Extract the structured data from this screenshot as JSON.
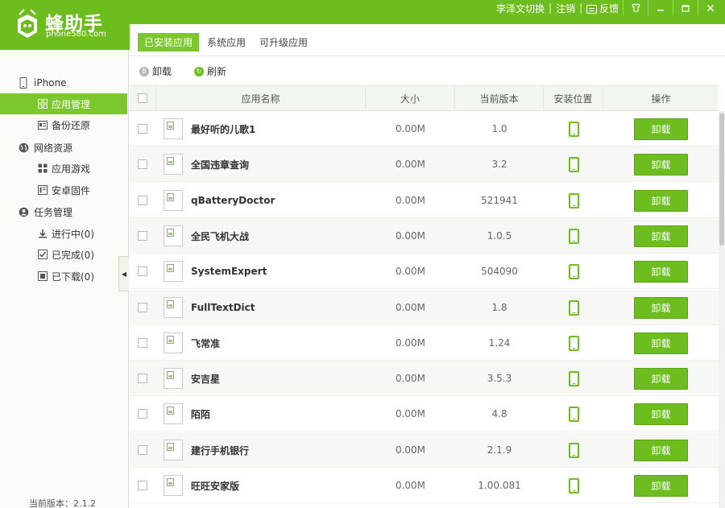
{
  "app": {
    "name": "蜂助手",
    "domain": "phone580.com"
  },
  "topbar": {
    "links": [
      "李泽文切换",
      "注销",
      "反馈"
    ],
    "window_buttons": {
      "skin_icon": "shirt-icon",
      "minimize_icon": "minimize-icon",
      "maximize_icon": "maximize-icon",
      "close_icon": "close-icon"
    }
  },
  "sidebar": {
    "groups": [
      {
        "label": "iPhone",
        "icon": "phone-icon",
        "items": [
          {
            "label": "应用管理",
            "icon": "grid-icon",
            "active": true
          },
          {
            "label": "备份还原",
            "icon": "backup-icon",
            "active": false
          }
        ]
      },
      {
        "label": "网络资源",
        "icon": "globe-icon",
        "items": [
          {
            "label": "应用游戏",
            "icon": "grid-icon",
            "active": false
          },
          {
            "label": "安卓固件",
            "icon": "firmware-icon",
            "active": false
          }
        ]
      },
      {
        "label": "任务管理",
        "icon": "task-icon",
        "items": [
          {
            "label": "进行中(0)",
            "icon": "download-arrow-icon",
            "active": false
          },
          {
            "label": "已完成(0)",
            "icon": "checkbox-icon",
            "active": false
          },
          {
            "label": "已下载(0)",
            "icon": "box-icon",
            "active": false
          }
        ]
      }
    ],
    "version_label": "当前版本：2.1.2"
  },
  "tabs": [
    {
      "label": "已安装应用",
      "active": true
    },
    {
      "label": "系统应用",
      "active": false
    },
    {
      "label": "可升级应用",
      "active": false
    }
  ],
  "toolbar": {
    "uninstall_label": "卸载",
    "refresh_label": "刷新"
  },
  "table": {
    "columns": [
      "应用名称",
      "大小",
      "当前版本",
      "安装位置",
      "操作"
    ],
    "rows": [
      {
        "name": "最好听的儿歌1",
        "size": "0.00M",
        "version": "1.0",
        "location_icon": "phone-icon",
        "action": "卸载"
      },
      {
        "name": "全国违章查询",
        "size": "0.00M",
        "version": "3.2",
        "location_icon": "phone-icon",
        "action": "卸载"
      },
      {
        "name": "qBatteryDoctor",
        "size": "0.00M",
        "version": "521941",
        "location_icon": "phone-icon",
        "action": "卸载"
      },
      {
        "name": "全民飞机大战",
        "size": "0.00M",
        "version": "1.0.5",
        "location_icon": "phone-icon",
        "action": "卸载"
      },
      {
        "name": "SystemExpert",
        "size": "0.00M",
        "version": "504090",
        "location_icon": "phone-icon",
        "action": "卸载"
      },
      {
        "name": "FullTextDict",
        "size": "0.00M",
        "version": "1.8",
        "location_icon": "phone-icon",
        "action": "卸载"
      },
      {
        "name": "飞常准",
        "size": "0.00M",
        "version": "1.24",
        "location_icon": "phone-icon",
        "action": "卸载"
      },
      {
        "name": "安吉星",
        "size": "0.00M",
        "version": "3.5.3",
        "location_icon": "phone-icon",
        "action": "卸载"
      },
      {
        "name": "陌陌",
        "size": "0.00M",
        "version": "4.8",
        "location_icon": "phone-icon",
        "action": "卸载"
      },
      {
        "name": "建行手机银行",
        "size": "0.00M",
        "version": "2.1.9",
        "location_icon": "phone-icon",
        "action": "卸载"
      },
      {
        "name": "旺旺安家版",
        "size": "0.00M",
        "version": "1.00.081",
        "location_icon": "phone-icon",
        "action": "卸载"
      }
    ]
  },
  "colors": {
    "brand_green": "#6dbd1f",
    "active_green": "#7cc62e"
  }
}
